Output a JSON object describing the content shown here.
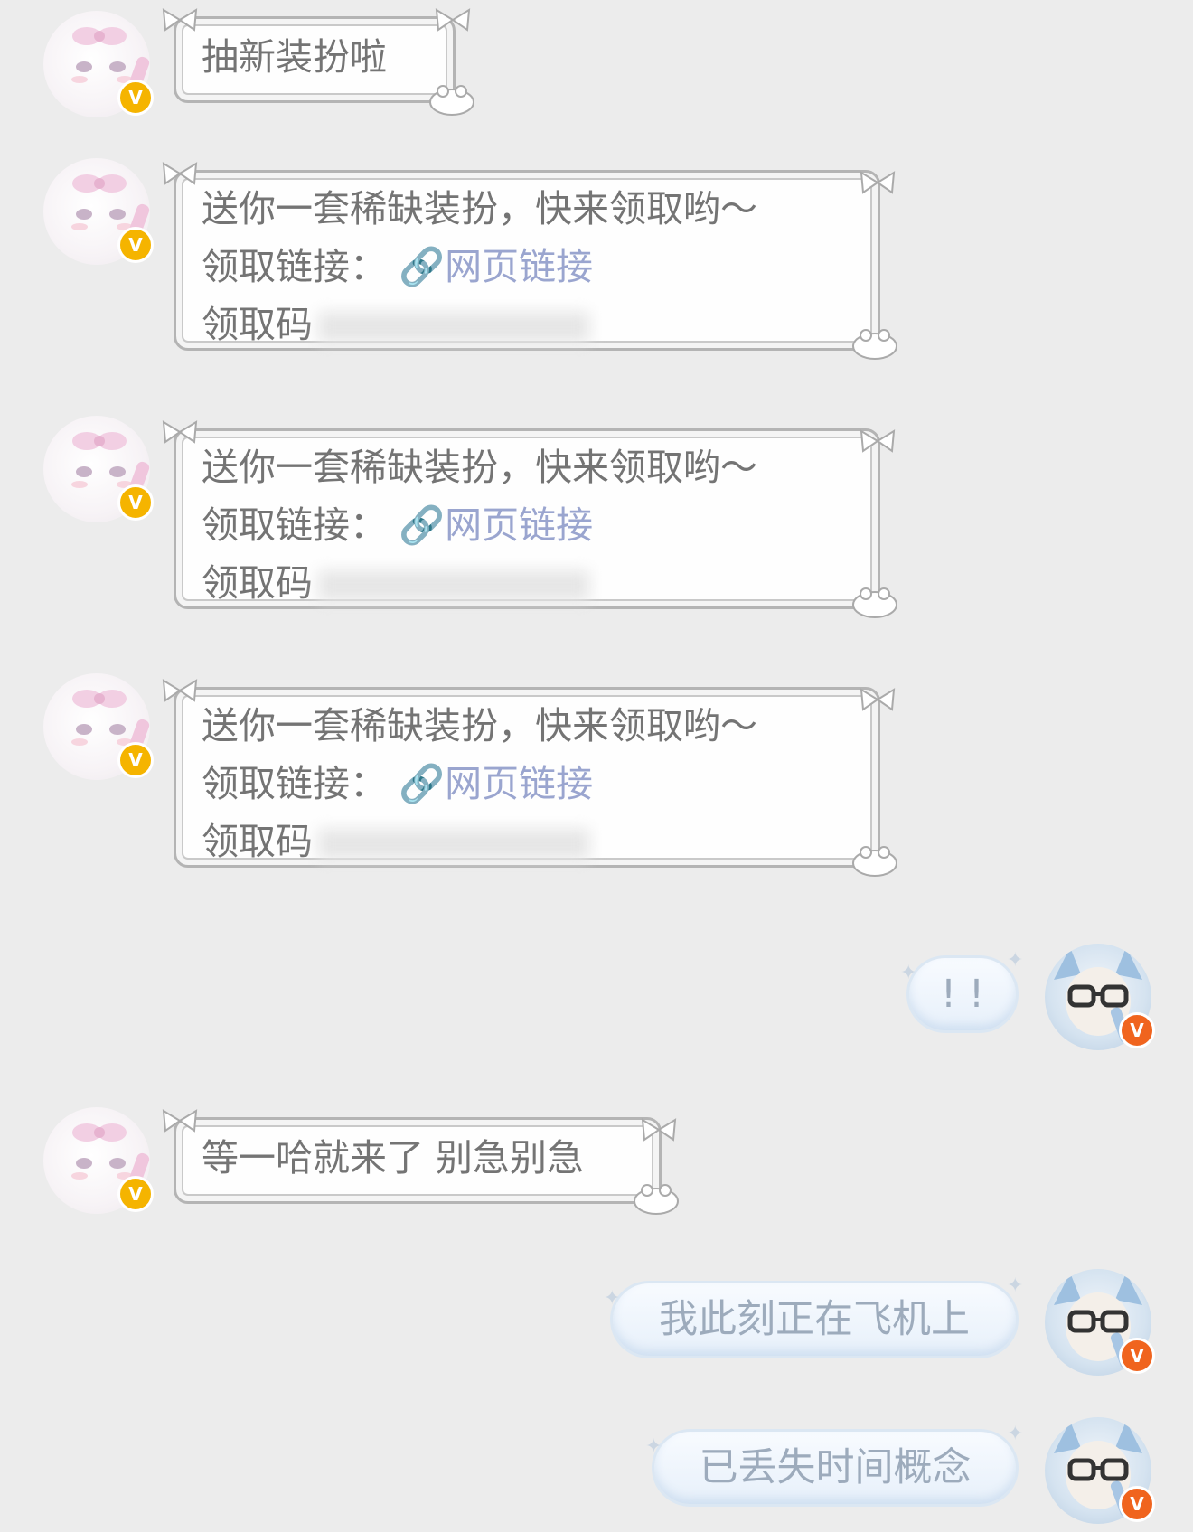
{
  "messages": [
    {
      "side": "left",
      "lines": [
        "抽新装扮啦"
      ]
    },
    {
      "side": "left",
      "lines": [
        "送你一套稀缺装扮，快来领取哟～",
        "领取链接：",
        "领取码"
      ],
      "link_label": "网页链接"
    },
    {
      "side": "left",
      "lines": [
        "送你一套稀缺装扮，快来领取哟～",
        "领取链接：",
        "领取码"
      ],
      "link_label": "网页链接"
    },
    {
      "side": "left",
      "lines": [
        "送你一套稀缺装扮，快来领取哟～",
        "领取链接：",
        "领取码"
      ],
      "link_label": "网页链接"
    },
    {
      "side": "right",
      "text": "! !"
    },
    {
      "side": "left",
      "lines": [
        "等一哈就来了 别急别急"
      ]
    },
    {
      "side": "right",
      "text": "我此刻正在飞机上"
    },
    {
      "side": "right",
      "text": "已丢失时间概念"
    }
  ],
  "badge_letter": "V",
  "icons": {
    "link": "link-icon",
    "left_avatar": "bunny-avatar",
    "right_avatar": "glasses-character-avatar"
  },
  "colors": {
    "background": "#ececec",
    "left_text": "#747474",
    "link": "#9aa5cf",
    "right_text": "#9dabbc",
    "badge_left": "#f5b400",
    "badge_right": "#f0641e"
  }
}
